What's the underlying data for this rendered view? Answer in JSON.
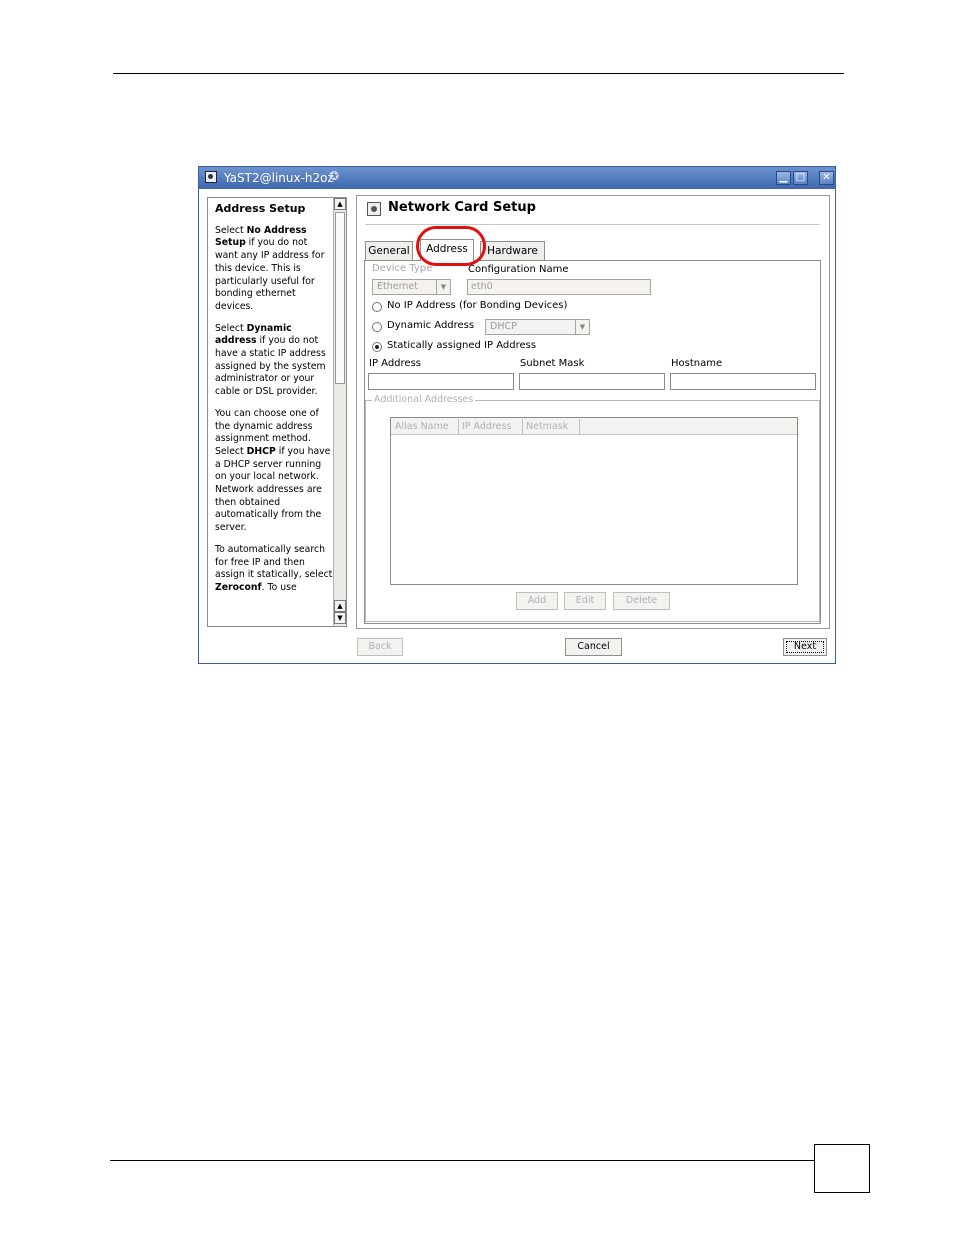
{
  "window": {
    "title": "YaST2@linux-h2oz"
  },
  "help": {
    "heading": "Address Setup",
    "p1_pre": "Select ",
    "p1_bold": "No Address Setup",
    "p1_post": " if you do not want any IP address for this device. This is particularly useful for bonding ethernet devices.",
    "p2_pre": "Select ",
    "p2_bold": "Dynamic address",
    "p2_post": " if you do not have a static IP address assigned by the system administrator or your cable or DSL provider.",
    "p3_pre": "You can choose one of the dynamic address assignment method. Select ",
    "p3_bold": "DHCP",
    "p3_post": " if you have a DHCP server running on your local network. Network addresses are then obtained automatically from the server.",
    "p4_pre": "To automatically search for free IP and then assign it statically, select ",
    "p4_bold": "Zeroconf",
    "p4_post": ". To use"
  },
  "main": {
    "title": "Network Card Setup",
    "tabs": [
      "General",
      "Address",
      "Hardware"
    ],
    "active_tab": "Address",
    "device_type_label": "Device Type",
    "device_type_value": "Ethernet",
    "config_name_label": "Configuration Name",
    "config_name_value": "eth0",
    "radio_no_ip": "No IP Address (for Bonding Devices)",
    "radio_dynamic": "Dynamic Address",
    "dynamic_value": "DHCP",
    "radio_static": "Statically assigned IP Address",
    "selected_radio": "Statically assigned IP Address",
    "ip_label": "IP Address",
    "subnet_label": "Subnet Mask",
    "hostname_label": "Hostname",
    "additional_label": "Additional Addresses",
    "table_columns": [
      "Alias Name",
      "IP Address",
      "Netmask"
    ],
    "add_label": "Add",
    "edit_label": "Edit",
    "delete_label": "Delete"
  },
  "footer": {
    "back": "Back",
    "cancel": "Cancel",
    "next": "Next"
  },
  "annotation": {
    "highlight_color": "#e20f0f"
  }
}
